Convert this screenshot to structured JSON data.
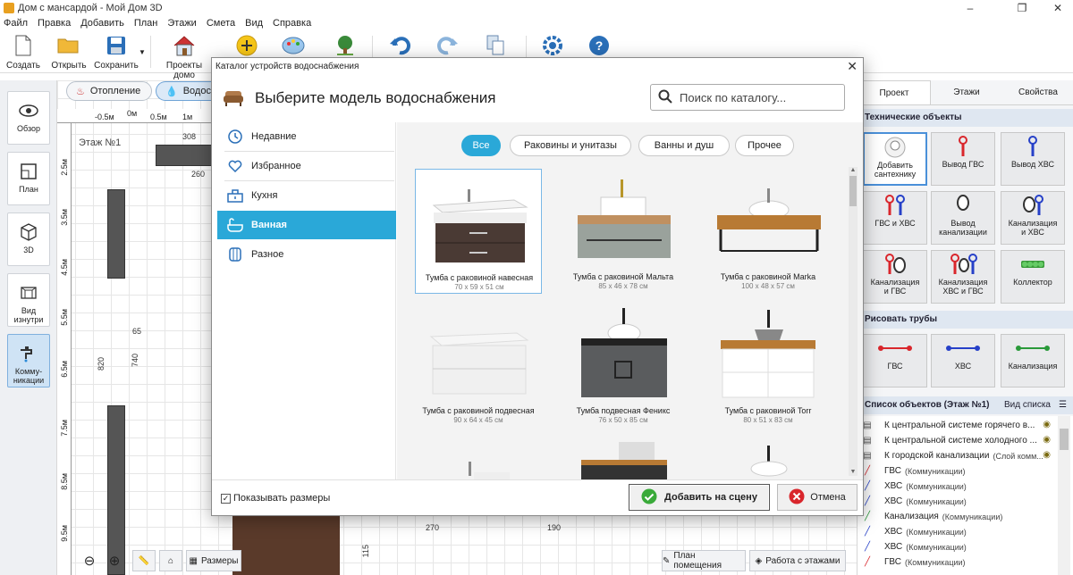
{
  "window": {
    "title": "Дом с мансардой - Мой Дом 3D"
  },
  "menu": [
    "Файл",
    "Правка",
    "Добавить",
    "План",
    "Этажи",
    "Смета",
    "Вид",
    "Справка"
  ],
  "toolbar": {
    "create": "Создать",
    "open": "Открыть",
    "save": "Сохранить",
    "projects": "Проекты домо"
  },
  "mode_pills": {
    "heating": "Отопление",
    "water": "Водос"
  },
  "left_nav": [
    "Обзор",
    "План",
    "3D",
    "Вид изнутри",
    "Комму-\nникации"
  ],
  "plan": {
    "floor_label": "Этаж №1",
    "ruler_h": [
      "-0.5м",
      "0м",
      "0.5м",
      "1м"
    ],
    "ruler_v": [
      "2.5м",
      "3.5м",
      "4.5м",
      "5.5м",
      "6.5м",
      "7.5м",
      "8.5м",
      "9.5м"
    ],
    "dims": {
      "d308": "308",
      "d260": "260",
      "d65": "65",
      "d740": "740",
      "d820": "820",
      "d270": "270",
      "d190": "190",
      "d115": "115"
    }
  },
  "bottom_tools": {
    "sizes": "Размеры",
    "room_plan": "План помещения",
    "floors_work": "Работа с этажами"
  },
  "right_panel": {
    "tabs": [
      "Проект",
      "Этажи",
      "Свойства"
    ],
    "tech_header": "Технические объекты",
    "tech_tiles": [
      "Добавить\nсантехнику",
      "Вывод ГВС",
      "Вывод ХВС",
      "ГВС и ХВС",
      "Вывод\nканализации",
      "Канализация\nи ХВС",
      "Канализация\nи ГВС",
      "Канализация\nХВС и ГВС",
      "Коллектор"
    ],
    "pipes_header": "Рисовать трубы",
    "pipe_tiles": [
      "ГВС",
      "ХВС",
      "Канализация"
    ],
    "list_header": "Список объектов (Этаж №1)",
    "list_view": "Вид списка",
    "objects": [
      {
        "name": "К центральной системе горячего в...",
        "sub": "",
        "eye": true,
        "kind": "doc"
      },
      {
        "name": "К центральной системе холодного ...",
        "sub": "",
        "eye": true,
        "kind": "doc"
      },
      {
        "name": "К городской канализации",
        "sub": "(Слой комм...",
        "eye": true,
        "kind": "doc"
      },
      {
        "name": "ГВС",
        "sub": "(Коммуникации)",
        "eye": false,
        "kind": "hot"
      },
      {
        "name": "ХВС",
        "sub": "(Коммуникации)",
        "eye": false,
        "kind": "cold"
      },
      {
        "name": "ХВС",
        "sub": "(Коммуникации)",
        "eye": false,
        "kind": "cold"
      },
      {
        "name": "Канализация",
        "sub": "(Коммуникации)",
        "eye": false,
        "kind": "sewer"
      },
      {
        "name": "ХВС",
        "sub": "(Коммуникации)",
        "eye": false,
        "kind": "cold"
      },
      {
        "name": "ХВС",
        "sub": "(Коммуникации)",
        "eye": false,
        "kind": "cold"
      },
      {
        "name": "ГВС",
        "sub": "(Коммуникации)",
        "eye": false,
        "kind": "hot"
      }
    ]
  },
  "dialog": {
    "title": "Каталог устройств водоснабжения",
    "heading": "Выберите модель водоснабжения",
    "search_placeholder": "Поиск по каталогу...",
    "categories": [
      "Недавние",
      "Избранное",
      "Кухня",
      "Ванная",
      "Разное"
    ],
    "active_category": "Ванная",
    "filters": [
      "Все",
      "Раковины и унитазы",
      "Ванны и душ",
      "Прочее"
    ],
    "active_filter": "Все",
    "items": [
      {
        "name": "Тумба с раковиной навесная",
        "size": "70 x 59 x 51 см"
      },
      {
        "name": "Тумба с раковиной Мальта",
        "size": "85 x 46 x 78 см"
      },
      {
        "name": "Тумба с раковиной Marka",
        "size": "100 x 48 x 57 см"
      },
      {
        "name": "Тумба с раковиной подвесная",
        "size": "90 x 64 x 45 см"
      },
      {
        "name": "Тумба подвесная Феникс",
        "size": "76 x 50 x 85 см"
      },
      {
        "name": "Тумба с раковиной Torr",
        "size": "80 x 51 x 83 см"
      }
    ],
    "show_sizes_label": "Показывать размеры",
    "add_button": "Добавить на сцену",
    "cancel_button": "Отмена"
  },
  "colors": {
    "accent": "#2aa8d8",
    "hot": "#d9262c",
    "cold": "#2640c8",
    "sewer": "#2a9a3a"
  }
}
